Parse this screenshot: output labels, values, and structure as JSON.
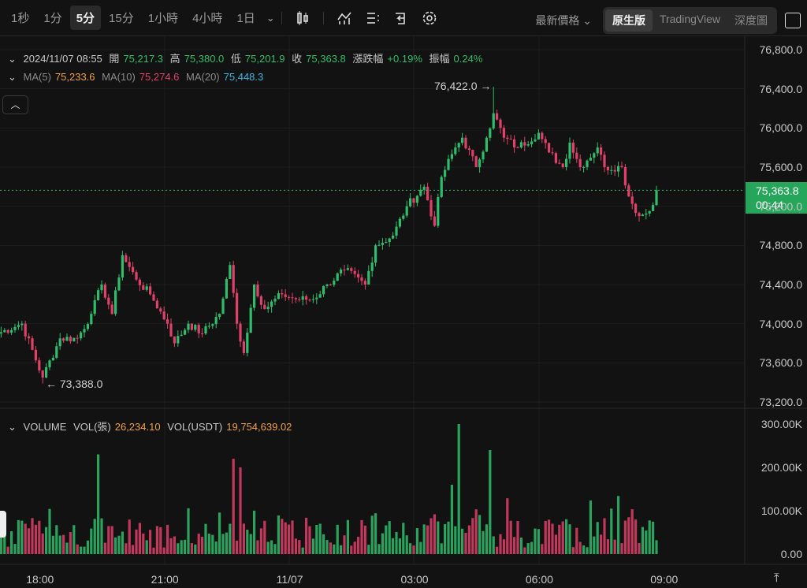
{
  "toolbar": {
    "timeframes": [
      "1秒",
      "1分",
      "5分",
      "15分",
      "1小時",
      "4小時",
      "1日"
    ],
    "active_timeframe": "5分",
    "price_select": "最新價格",
    "views": [
      "原生版",
      "TradingView",
      "深度圖"
    ],
    "active_view": "原生版"
  },
  "legend": {
    "datetime": "2024/11/07 08:55",
    "open_label": "開",
    "open": "75,217.3",
    "high_label": "高",
    "high": "75,380.0",
    "low_label": "低",
    "low": "75,201.9",
    "close_label": "收",
    "close": "75,363.8",
    "change_label": "漲跌幅",
    "change": "+0.19%",
    "amp_label": "振幅",
    "amp": "0.24%",
    "ma5_label": "MA(5)",
    "ma5": "75,233.6",
    "ma10_label": "MA(10)",
    "ma10": "75,274.6",
    "ma20_label": "MA(20)",
    "ma20": "75,448.3"
  },
  "volume_legend": {
    "title": "VOLUME",
    "vol_label": "VOL(張)",
    "vol": "26,234.10",
    "usdt_label": "VOL(USDT)",
    "usdt": "19,754,639.02"
  },
  "annotations": {
    "high": "76,422.0 →",
    "low": "← 73,388.0"
  },
  "last_price": {
    "price": "75,363.8",
    "countdown": "00:44"
  },
  "colors": {
    "up": "#2ebd6b",
    "down": "#e0406a",
    "bg": "#121212"
  },
  "chart_data": {
    "type": "candlestick",
    "price_ticks": [
      "76,800.0",
      "76,400.0",
      "76,000.0",
      "75,600.0",
      "75,200.0",
      "74,800.0",
      "74,400.0",
      "74,000.0",
      "73,600.0",
      "73,200.0"
    ],
    "price_range": [
      73200,
      76800
    ],
    "volume_ticks": [
      "300.00K",
      "200.00K",
      "100.00K",
      "0.00"
    ],
    "volume_range": [
      0,
      300000
    ],
    "time_ticks": [
      {
        "label": "18:00",
        "candle": 12
      },
      {
        "label": "21:00",
        "candle": 48
      },
      {
        "label": "11/07",
        "candle": 84
      },
      {
        "label": "03:00",
        "candle": 120
      },
      {
        "label": "06:00",
        "candle": 156
      },
      {
        "label": "09:00",
        "candle": 192
      }
    ],
    "price_keypoints": [
      [
        0,
        73900
      ],
      [
        7,
        74000
      ],
      [
        13,
        73450
      ],
      [
        18,
        73850
      ],
      [
        23,
        73850
      ],
      [
        27,
        74100
      ],
      [
        30,
        74400
      ],
      [
        33,
        74100
      ],
      [
        36,
        74700
      ],
      [
        40,
        74450
      ],
      [
        44,
        74300
      ],
      [
        49,
        74000
      ],
      [
        51,
        73800
      ],
      [
        55,
        74000
      ],
      [
        59,
        73900
      ],
      [
        64,
        74100
      ],
      [
        67,
        74600
      ],
      [
        69,
        74000
      ],
      [
        71,
        73700
      ],
      [
        74,
        74400
      ],
      [
        77,
        74150
      ],
      [
        82,
        74300
      ],
      [
        86,
        74250
      ],
      [
        91,
        74250
      ],
      [
        95,
        74400
      ],
      [
        100,
        74550
      ],
      [
        106,
        74400
      ],
      [
        109,
        74800
      ],
      [
        114,
        74900
      ],
      [
        118,
        75200
      ],
      [
        123,
        75400
      ],
      [
        126,
        75000
      ],
      [
        128,
        75500
      ],
      [
        132,
        75800
      ],
      [
        134,
        75900
      ],
      [
        138,
        75600
      ],
      [
        141,
        75900
      ],
      [
        143,
        76150
      ],
      [
        146,
        75900
      ],
      [
        150,
        75800
      ],
      [
        156,
        75950
      ],
      [
        159,
        75750
      ],
      [
        163,
        75600
      ],
      [
        165,
        75850
      ],
      [
        168,
        75600
      ],
      [
        173,
        75800
      ],
      [
        175,
        75600
      ],
      [
        180,
        75600
      ],
      [
        182,
        75300
      ],
      [
        185,
        75100
      ],
      [
        188,
        75150
      ],
      [
        190,
        75364
      ]
    ],
    "volume_spikes": [
      [
        29,
        230000
      ],
      [
        68,
        220000
      ],
      [
        70,
        200000
      ],
      [
        131,
        160000
      ],
      [
        133,
        300000
      ],
      [
        142,
        240000
      ],
      [
        177,
        105000
      ]
    ],
    "high": 76422.0,
    "low": 73388.0
  }
}
